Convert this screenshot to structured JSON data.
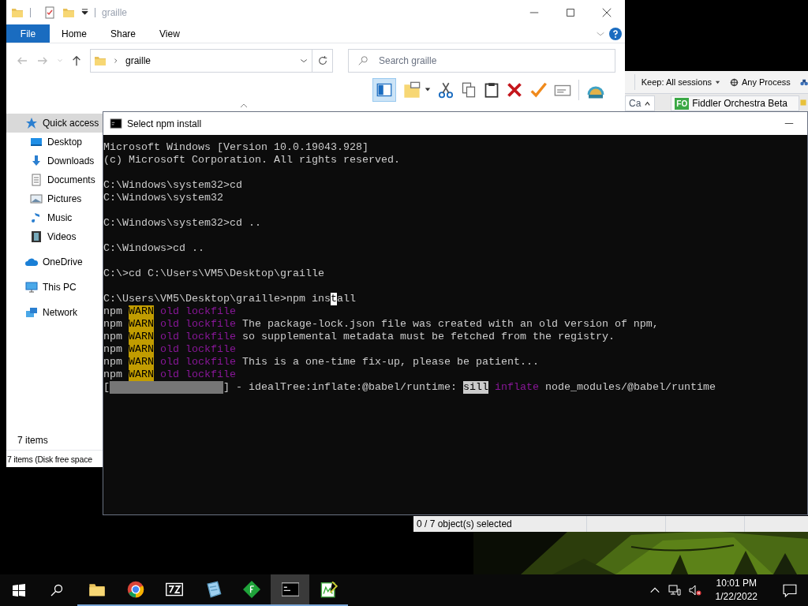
{
  "explorer": {
    "title": "graille",
    "ribbon_tabs": [
      {
        "label": "File",
        "kind": "file"
      },
      {
        "label": "Home",
        "kind": "tab"
      },
      {
        "label": "Share",
        "kind": "tab"
      },
      {
        "label": "View",
        "kind": "tab"
      }
    ],
    "address": {
      "path": "graille"
    },
    "search": {
      "placeholder": "Search graille"
    },
    "nav": [
      {
        "label": "Quick access",
        "kind": "star",
        "selected": true,
        "children": [
          {
            "label": "Desktop",
            "kind": "desktop",
            "selected": false
          },
          {
            "label": "Downloads",
            "kind": "download",
            "selected": false
          },
          {
            "label": "Documents",
            "kind": "document",
            "selected": false
          },
          {
            "label": "Pictures",
            "kind": "pictures",
            "selected": false
          },
          {
            "label": "Music",
            "kind": "music",
            "selected": false
          },
          {
            "label": "Videos",
            "kind": "video",
            "selected": false
          }
        ]
      },
      {
        "label": "OneDrive",
        "kind": "cloud",
        "selected": false
      },
      {
        "label": "This PC",
        "kind": "pc",
        "selected": false
      },
      {
        "label": "Network",
        "kind": "network",
        "selected": false
      }
    ],
    "item_count": "7 items",
    "status_bar": "7 items (Disk free space"
  },
  "fiddler": {
    "keep": "Keep: All sessions",
    "process": "Any Process",
    "tab_stub": "Ca",
    "tab": {
      "badge": "FO",
      "label": "Fiddler Orchestra Beta"
    },
    "status_bar": "0 / 7 object(s) selected"
  },
  "console": {
    "title": "Select npm install",
    "blocks": [
      [
        [
          {
            "text": "Microsoft Windows [Version 10.0.19043.928]",
            "kind": "plain"
          }
        ],
        [
          {
            "text": "(c) Microsoft Corporation. All rights reserved.",
            "kind": "plain"
          }
        ]
      ],
      [
        [
          {
            "text": "C:\\Windows\\system32>cd",
            "kind": "plain"
          }
        ],
        [
          {
            "text": "C:\\Windows\\system32",
            "kind": "plain"
          }
        ]
      ],
      [
        [
          {
            "text": "C:\\Windows\\system32>cd ..",
            "kind": "plain"
          }
        ]
      ],
      [
        [
          {
            "text": "C:\\Windows>cd ..",
            "kind": "plain"
          }
        ]
      ],
      [
        [
          {
            "text": "C:\\>cd C:\\Users\\VM5\\Desktop\\graille",
            "kind": "plain"
          }
        ]
      ],
      [
        [
          {
            "text": "C:\\Users\\VM5\\Desktop\\graille>npm ins",
            "kind": "plain"
          },
          {
            "text": "t",
            "kind": "cursor"
          },
          {
            "text": "all",
            "kind": "plain"
          }
        ],
        [
          {
            "text": "npm",
            "kind": "plain"
          },
          {
            "text": "WARN",
            "kind": "warn"
          },
          {
            "text": "old lockfile",
            "kind": "magenta"
          }
        ],
        [
          {
            "text": "npm",
            "kind": "plain"
          },
          {
            "text": "WARN",
            "kind": "warn"
          },
          {
            "text": "old lockfile",
            "kind": "magenta"
          },
          {
            "text": "The package-lock.json file was created with an old version of npm,",
            "kind": "plain"
          }
        ],
        [
          {
            "text": "npm",
            "kind": "plain"
          },
          {
            "text": "WARN",
            "kind": "warn"
          },
          {
            "text": "old lockfile",
            "kind": "magenta"
          },
          {
            "text": "so supplemental metadata must be fetched from the registry.",
            "kind": "plain"
          }
        ],
        [
          {
            "text": "npm",
            "kind": "plain"
          },
          {
            "text": "WARN",
            "kind": "warn"
          },
          {
            "text": "old lockfile",
            "kind": "magenta"
          }
        ],
        [
          {
            "text": "npm",
            "kind": "plain"
          },
          {
            "text": "WARN",
            "kind": "warn"
          },
          {
            "text": "old lockfile",
            "kind": "magenta"
          },
          {
            "text": "This is a one-time fix-up, please be patient...",
            "kind": "plain"
          }
        ],
        [
          {
            "text": "npm",
            "kind": "plain"
          },
          {
            "text": "WARN",
            "kind": "warn"
          },
          {
            "text": "old lockfile",
            "kind": "magenta"
          }
        ],
        [
          {
            "text": "[",
            "kind": "plain"
          },
          {
            "kind": "gauge",
            "level": 1
          },
          {
            "text": "] - idealTree:inflate:@babel/runtime:",
            "kind": "plain"
          },
          {
            "text": "sill",
            "kind": "sill"
          },
          {
            "text": "inflate",
            "kind": "magenta"
          },
          {
            "text": "node_modules/@babel/runtime",
            "kind": "plain"
          }
        ]
      ]
    ]
  },
  "taskbar": {
    "apps": [
      {
        "kind": "folder",
        "selected": false
      },
      {
        "kind": "chrome",
        "selected": false
      },
      {
        "kind": "zip",
        "selected": false
      },
      {
        "kind": "notepad",
        "selected": false
      },
      {
        "kind": "diamond",
        "selected": false
      },
      {
        "kind": "console",
        "selected": true
      },
      {
        "kind": "editor",
        "selected": false
      }
    ],
    "time": "10:01 PM",
    "date": "1/22/2022"
  }
}
